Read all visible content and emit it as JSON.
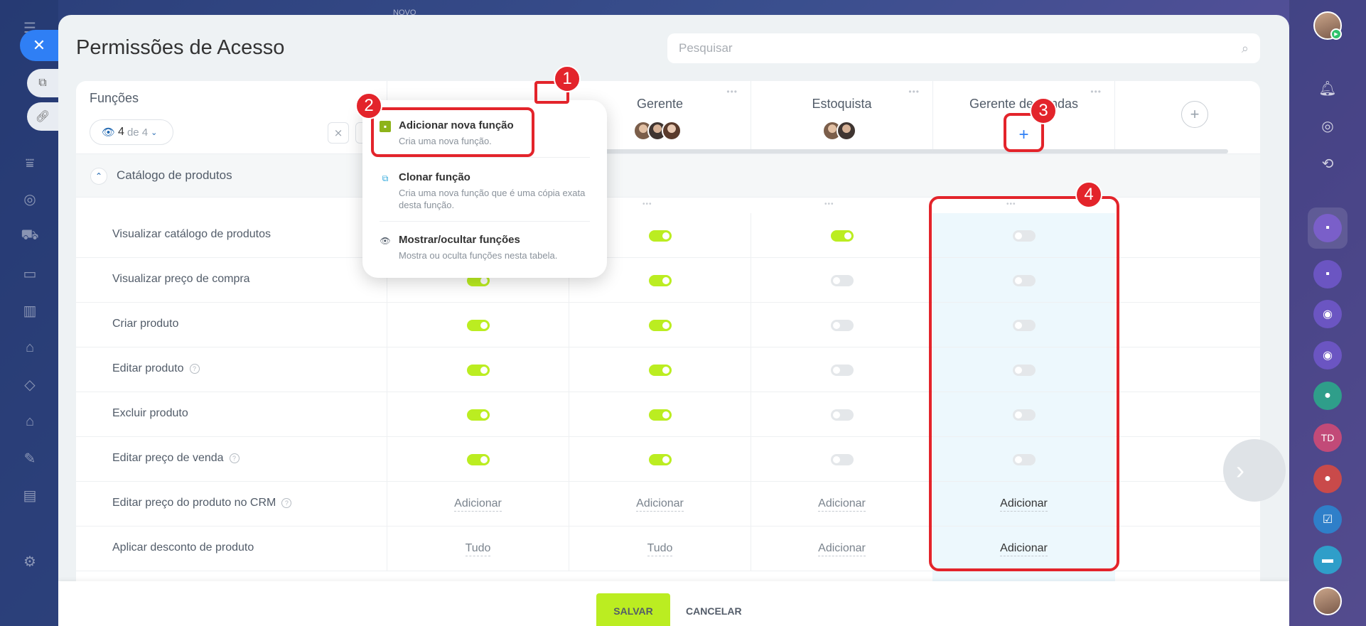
{
  "background": {
    "novo_label": "NOVO"
  },
  "page": {
    "title": "Permissões de Acesso"
  },
  "search": {
    "placeholder": "Pesquisar"
  },
  "roles_header": {
    "label": "Funções",
    "visible_count": "4",
    "visible_of": "de 4"
  },
  "columns": [
    {
      "name": "",
      "avatars": 0
    },
    {
      "name": "Gerente",
      "avatars": 3
    },
    {
      "name": "Estoquista",
      "avatars": 2
    },
    {
      "name": "Gerente de vendas",
      "avatars": 0
    }
  ],
  "section": {
    "title": "Catálogo de produtos"
  },
  "rows": [
    {
      "label": "Visualizar catálogo de produtos",
      "help": false,
      "values": [
        "",
        "on",
        "on",
        "off"
      ]
    },
    {
      "label": "Visualizar preço de compra",
      "help": false,
      "values": [
        "on",
        "on",
        "off",
        "off"
      ]
    },
    {
      "label": "Criar produto",
      "help": false,
      "values": [
        "on",
        "on",
        "off",
        "off"
      ]
    },
    {
      "label": "Editar produto",
      "help": true,
      "values": [
        "on",
        "on",
        "off",
        "off"
      ]
    },
    {
      "label": "Excluir produto",
      "help": false,
      "values": [
        "on",
        "on",
        "off",
        "off"
      ]
    },
    {
      "label": "Editar preço de venda",
      "help": true,
      "values": [
        "on",
        "on",
        "off",
        "off"
      ]
    },
    {
      "label": "Editar preço do produto no CRM",
      "help": true,
      "values": [
        "Adicionar",
        "Adicionar",
        "Adicionar",
        "Adicionar"
      ]
    },
    {
      "label": "Aplicar desconto de produto",
      "help": false,
      "values": [
        "Tudo",
        "Tudo",
        "Adicionar",
        "Adicionar"
      ]
    }
  ],
  "popup": {
    "items": [
      {
        "title": "Adicionar nova função",
        "desc": "Cria uma nova função.",
        "icon": "add-role-icon"
      },
      {
        "title": "Clonar função",
        "desc": "Cria uma nova função que é uma cópia exata desta função.",
        "icon": "clone-icon"
      },
      {
        "title": "Mostrar/ocultar funções",
        "desc": "Mostra ou oculta funções nesta tabela.",
        "icon": "eye-icon"
      }
    ]
  },
  "footer": {
    "save_label": "SALVAR",
    "cancel_label": "CANCELAR"
  },
  "right_rail": {
    "initials": "TD"
  },
  "annotations": [
    "1",
    "2",
    "3",
    "4"
  ],
  "colors": {
    "accent_green": "#bbed21",
    "accent_blue": "#2f7ff5",
    "annotation_red": "#e3242b",
    "highlight_column": "#edf8fd"
  }
}
